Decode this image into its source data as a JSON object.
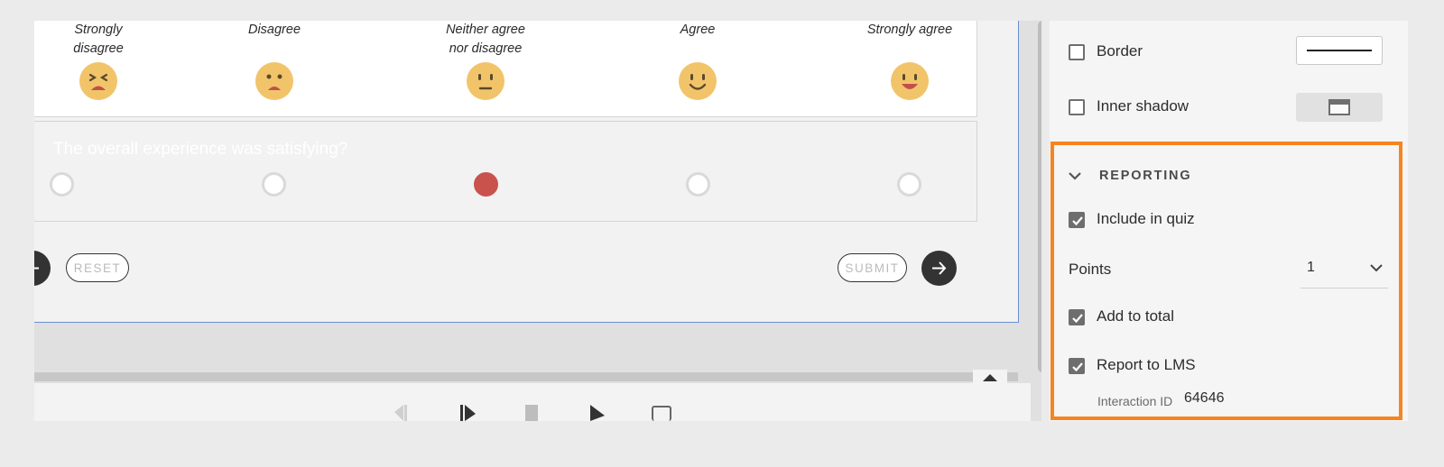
{
  "likert": {
    "scale": [
      {
        "line1": "Strongly",
        "line2": "disagree"
      },
      {
        "line1": "Disagree",
        "line2": ""
      },
      {
        "line1": "Neither agree",
        "line2": "nor disagree"
      },
      {
        "line1": "Agree",
        "line2": ""
      },
      {
        "line1": "Strongly agree",
        "line2": ""
      }
    ],
    "emoji_icons": [
      "angry-face-icon",
      "sad-face-icon",
      "neutral-face-icon",
      "smile-face-icon",
      "happy-face-icon"
    ],
    "question": "The overall experience was satisfying?",
    "selected_index": 2
  },
  "buttons": {
    "reset": "RESET",
    "submit": "SUBMIT"
  },
  "properties": {
    "border_label": "Border",
    "border_checked": false,
    "inner_shadow_label": "Inner shadow",
    "inner_shadow_checked": false
  },
  "reporting": {
    "title": "REPORTING",
    "include_in_quiz_label": "Include in quiz",
    "include_in_quiz_checked": true,
    "points_label": "Points",
    "points_value": "1",
    "add_to_total_label": "Add to total",
    "add_to_total_checked": true,
    "report_lms_label": "Report to LMS",
    "report_lms_checked": true,
    "interaction_id_label": "Interaction ID",
    "interaction_id_value": "64646"
  },
  "colors": {
    "highlight": "#f58520",
    "selected_radio": "#c9524d",
    "emoji": "#f2c46a"
  }
}
